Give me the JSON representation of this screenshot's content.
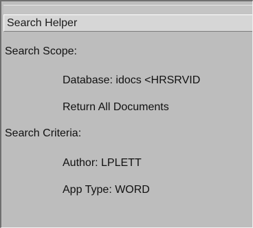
{
  "panel": {
    "title": "Search Helper",
    "sections": [
      {
        "label": "Search Scope:",
        "items": [
          "Database: idocs <HRSRVID",
          "Return All Documents"
        ]
      },
      {
        "label": "Search Criteria:",
        "items": [
          "Author: LPLETT",
          "App Type: WORD"
        ]
      }
    ]
  }
}
